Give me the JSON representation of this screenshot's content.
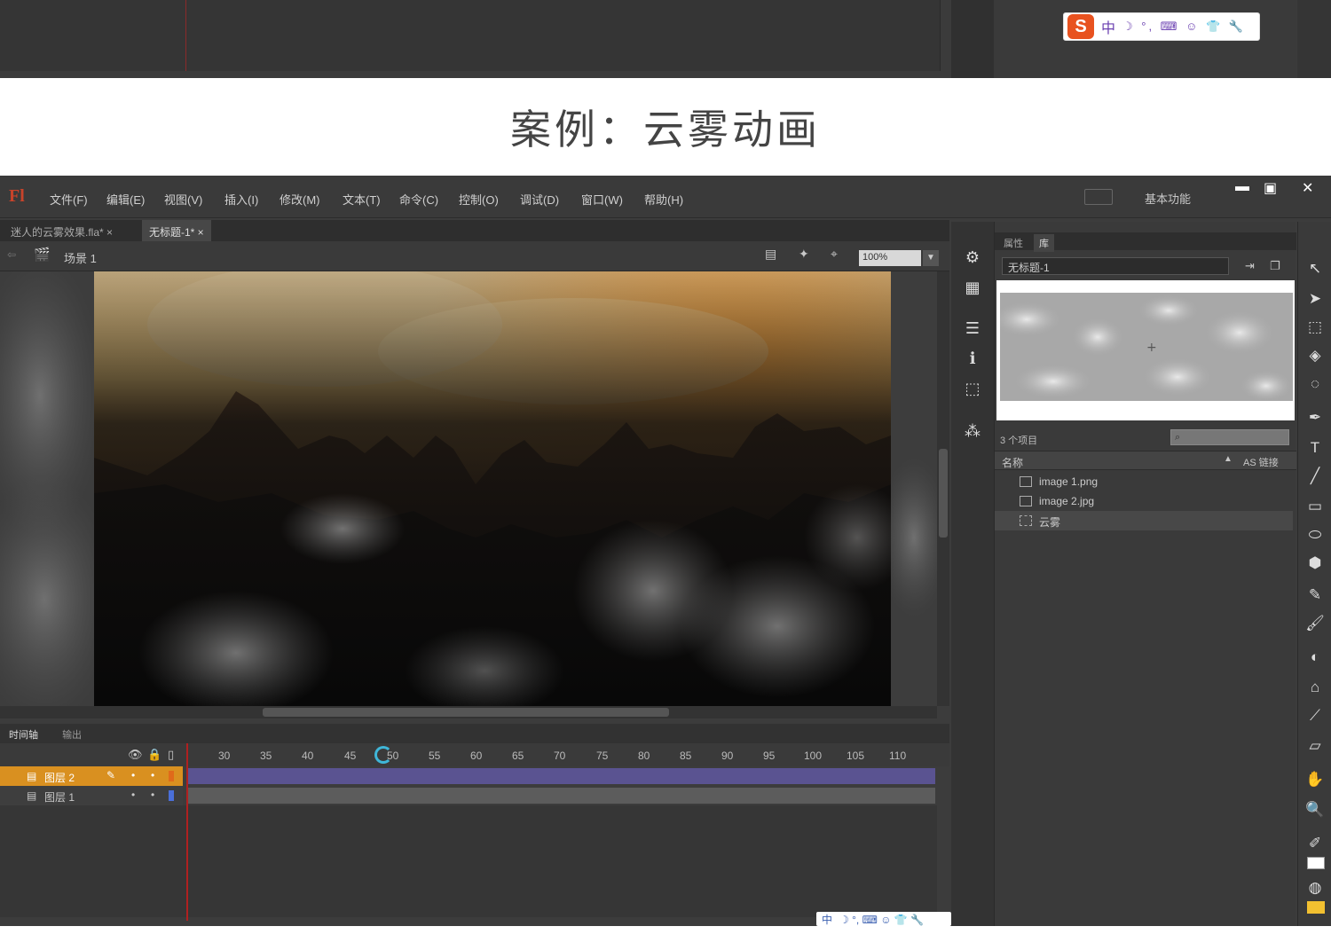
{
  "page_title": "案例：云雾动画",
  "ime": {
    "logo": "S",
    "mode": "中",
    "icons": "☽ °, ⌨ ☺ 👕 🔧"
  },
  "menubar": {
    "logo": "Fl",
    "items": [
      "文件(F)",
      "编辑(E)",
      "视图(V)",
      "插入(I)",
      "修改(M)",
      "文本(T)",
      "命令(C)",
      "控制(O)",
      "调试(D)",
      "窗口(W)",
      "帮助(H)"
    ],
    "workspace": "基本功能",
    "window_controls": {
      "minimize": "▬",
      "restore": "▣",
      "close": "✕"
    }
  },
  "doc_tabs": [
    {
      "label": "迷人的云雾效果.fla* ×",
      "active": false
    },
    {
      "label": "无标题-1* ×",
      "active": true
    }
  ],
  "scene": {
    "label": "场景 1",
    "zoom": "100%"
  },
  "timeline": {
    "tabs": [
      "时间轴",
      "输出"
    ],
    "ruler": [
      "30",
      "35",
      "40",
      "45",
      "50",
      "55",
      "60",
      "65",
      "70",
      "75",
      "80",
      "85",
      "90",
      "95",
      "100",
      "105",
      "110"
    ],
    "layers": [
      {
        "name": "图层 2",
        "selected": true
      },
      {
        "name": "图层 1",
        "selected": false
      }
    ]
  },
  "library": {
    "tabs": [
      "属性",
      "库"
    ],
    "document": "无标题-1",
    "count": "3 个项目",
    "column_name": "名称",
    "column_linkage": "AS 链接",
    "items": [
      "image 1.png",
      "image 2.jpg",
      "云雾"
    ]
  },
  "colors": {
    "accent_layer": "#d99020",
    "frames": "#5a5391",
    "playhead": "#b02020"
  }
}
